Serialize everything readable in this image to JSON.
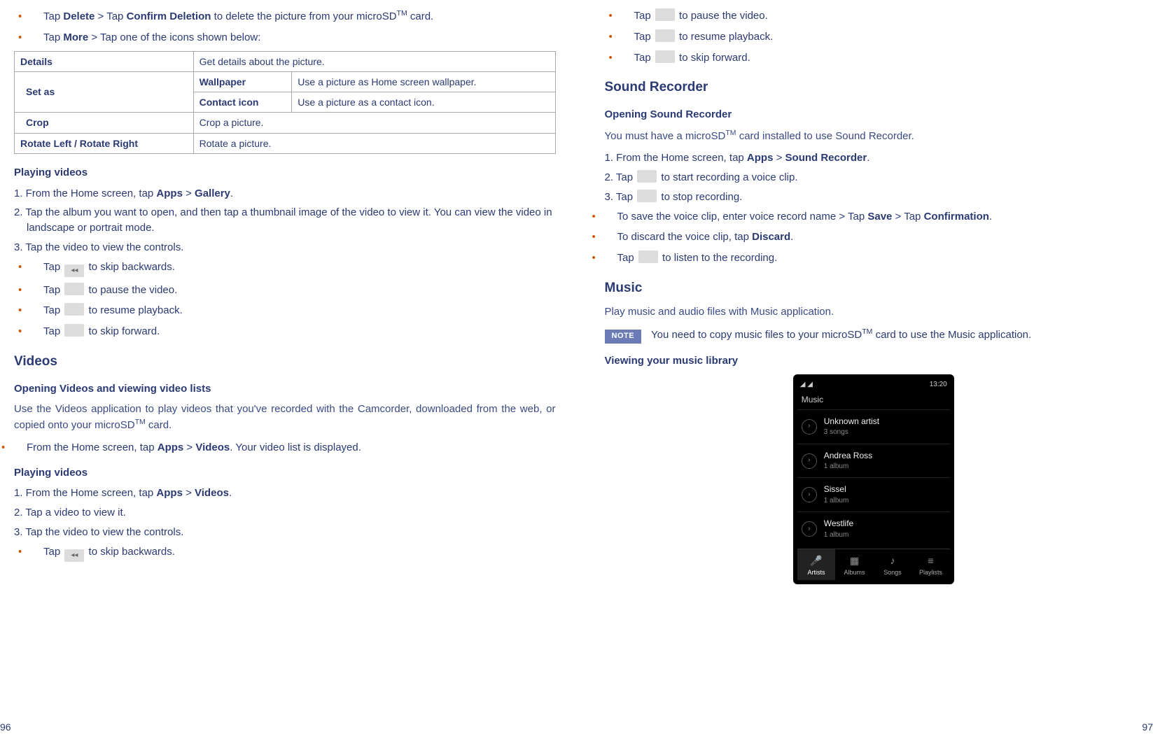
{
  "left": {
    "bul1_pre": "Tap ",
    "bul1_b1": "Delete",
    "bul1_mid": " > Tap ",
    "bul1_b2": "Confirm Deletion",
    "bul1_post": " to delete the picture from your microSD",
    "bul1_post2": " card.",
    "bul2_pre": "Tap ",
    "bul2_b1": "More",
    "bul2_post": " > Tap one of the icons shown below:",
    "table": {
      "details_h": "Details",
      "details_v": "Get details about the picture.",
      "setas_h": "Set as",
      "wallpaper_h": "Wallpaper",
      "wallpaper_v": "Use a picture as Home screen wallpaper.",
      "contacticon_h": "Contact icon",
      "contacticon_v": "Use a picture as a contact icon.",
      "crop_h": "Crop",
      "crop_v": "Crop a picture.",
      "rotate_h": "Rotate Left / Rotate Right",
      "rotate_v": "Rotate a picture."
    },
    "pv_head": "Playing videos",
    "pv1_pre": "1. From the Home screen, tap ",
    "pv1_b1": "Apps",
    "pv1_mid": " > ",
    "pv1_b2": "Gallery",
    "pv1_post": ".",
    "pv2": "2. Tap the album you want to open, and then tap a thumbnail image of the video to view it. You can view the video in landscape or portrait mode.",
    "pv3": "3. Tap the video to view the controls.",
    "vc_back": " to skip backwards.",
    "vc_pause": " to pause the video.",
    "vc_resume": " to resume playback.",
    "vc_fwd": " to skip forward.",
    "tap": "Tap ",
    "videos_h": "Videos",
    "ovvl_h": "Opening Videos and viewing video lists",
    "ovvl_p": "Use the Videos application to play videos that you've recorded with the Camcorder, downloaded from the web, or copied onto your microSD",
    "ovvl_p2": " card.",
    "ov_b_pre": "From the Home screen, tap ",
    "ov_b_b1": "Apps",
    "ov_b_mid": " > ",
    "ov_b_b2": "Videos",
    "ov_b_post": ".  Your video list is displayed.",
    "pv2h": "Playing videos",
    "pv21_pre": "1. From the Home screen, tap ",
    "pv21_b1": "Apps",
    "pv21_mid": " > ",
    "pv21_b2": "Videos",
    "pv21_post": ".",
    "pv22": "2. Tap a video to view it.",
    "pv23": "3. Tap the video to view the controls.",
    "pgnum": "96"
  },
  "right": {
    "tap": "Tap ",
    "vc_pause": " to pause the video.",
    "vc_resume": " to resume playback.",
    "vc_fwd": " to skip forward.",
    "sr_h": "Sound Recorder",
    "osr_h": "Opening Sound Recorder",
    "osr_p": "You must have a microSD",
    "osr_p2": " card installed to use Sound Recorder.",
    "sr1_pre": "1. From the Home screen, tap ",
    "sr1_b1": "Apps",
    "sr1_mid": " > ",
    "sr1_b2": "Sound Recorder",
    "sr1_post": ".",
    "sr2_pre": "2. Tap ",
    "sr2_post": " to start recording a voice clip.",
    "sr3_pre": "3. Tap ",
    "sr3_post": " to stop recording.",
    "sr_b1_pre": "To save the voice clip, enter voice record name > Tap ",
    "sr_b1_b1": "Save",
    "sr_b1_mid": " > Tap ",
    "sr_b1_b2": "Confirmation",
    "sr_b1_post": ".",
    "sr_b2_pre": "To discard the voice clip, tap ",
    "sr_b2_b1": "Discard",
    "sr_b2_post": ".",
    "sr_b3_pre": "Tap ",
    "sr_b3_post": " to listen to the recording.",
    "music_h": "Music",
    "music_p": "Play music and audio files with Music application.",
    "note_label": "NOTE",
    "note_txt": "You need to copy music files to your microSD",
    "note_txt2": " card to use the Music application.",
    "vyml_h": "Viewing your music library",
    "phone": {
      "time": "13:20",
      "app": "Music",
      "rows": [
        {
          "t1": "Unknown artist",
          "t2": "3 songs"
        },
        {
          "t1": "Andrea Ross",
          "t2": "1 album"
        },
        {
          "t1": "Sissel",
          "t2": "1 album"
        },
        {
          "t1": "Westlife",
          "t2": "1 album"
        }
      ],
      "tabs": [
        "Artists",
        "Albums",
        "Songs",
        "Playlists"
      ]
    },
    "pgnum": "97"
  },
  "tm": "TM"
}
